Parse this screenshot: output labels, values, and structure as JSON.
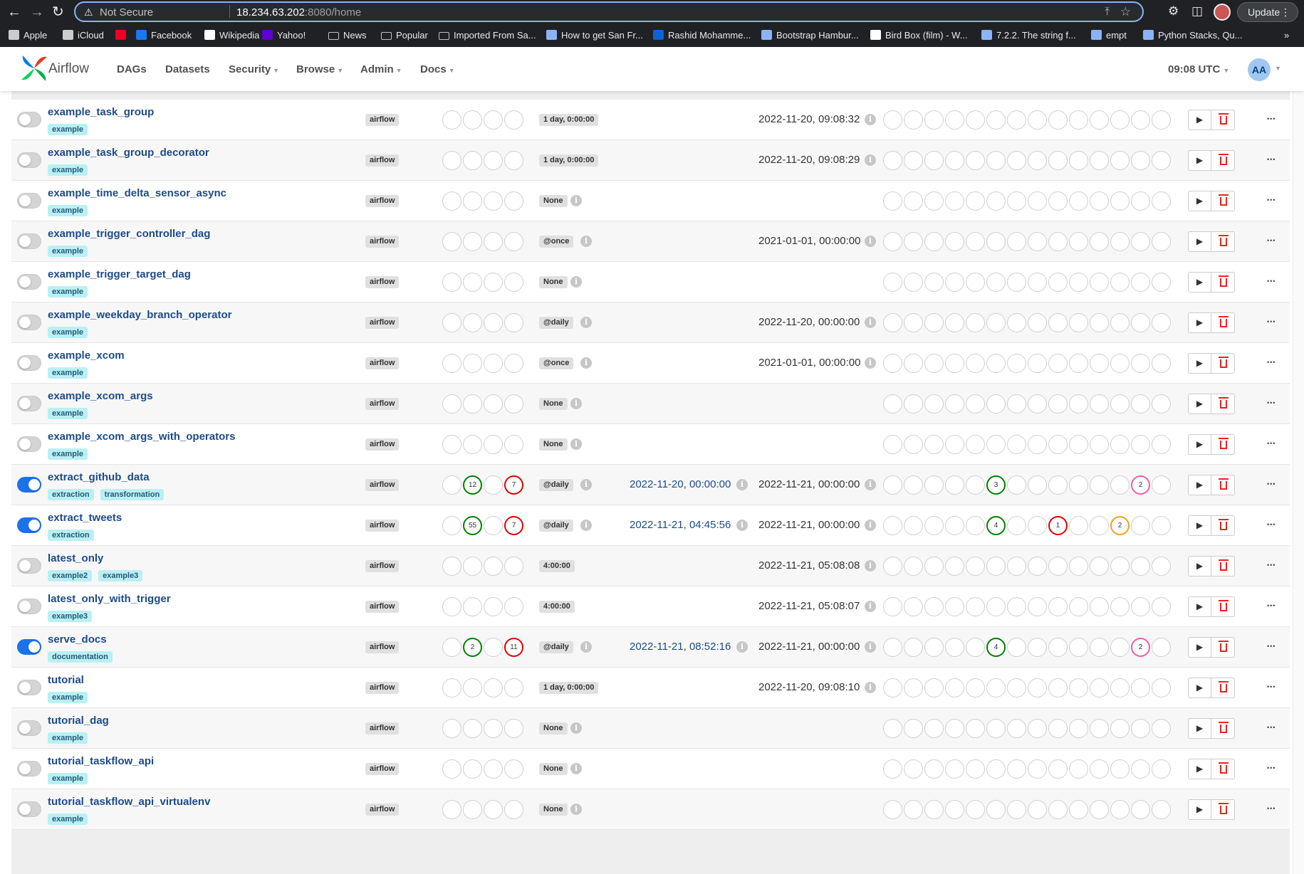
{
  "browser": {
    "security_label": "Not Secure",
    "url_host": "18.234.63.202",
    "url_rest": ":8080/home",
    "update_label": "Update",
    "bookmarks": [
      "Apple",
      "iCloud",
      "",
      "Facebook",
      "Wikipedia",
      "Yahoo!",
      "News",
      "Popular",
      "Imported From Sa...",
      "How to get San Fr...",
      "Rashid Mohamme...",
      "Bootstrap Hambur...",
      "Bird Box (film) - W...",
      "7.2.2. The string f...",
      "empt",
      "Python Stacks, Qu..."
    ]
  },
  "nav": {
    "brand": "Airflow",
    "menu": [
      "DAGs",
      "Datasets",
      "Security",
      "Browse",
      "Admin",
      "Docs"
    ],
    "time": "09:08 UTC",
    "user_initials": "AA"
  },
  "rows": [
    {
      "name": "example_task_group",
      "tags": [
        "example"
      ],
      "owner": "airflow",
      "on": false,
      "runs": [],
      "schedule": "1 day, 0:00:00",
      "sched_info": false,
      "last_run": "",
      "next_run": "2022-11-20, 09:08:32",
      "tasks": []
    },
    {
      "name": "example_task_group_decorator",
      "tags": [
        "example"
      ],
      "owner": "airflow",
      "on": false,
      "runs": [],
      "schedule": "1 day, 0:00:00",
      "sched_info": false,
      "last_run": "",
      "next_run": "2022-11-20, 09:08:29",
      "tasks": []
    },
    {
      "name": "example_time_delta_sensor_async",
      "tags": [
        "example"
      ],
      "owner": "airflow",
      "on": false,
      "runs": [],
      "schedule": "None",
      "sched_info": true,
      "last_run": "",
      "next_run": "",
      "tasks": []
    },
    {
      "name": "example_trigger_controller_dag",
      "tags": [
        "example"
      ],
      "owner": "airflow",
      "on": false,
      "runs": [],
      "schedule": "@once",
      "sched_info": true,
      "last_run": "",
      "next_run": "2021-01-01, 00:00:00",
      "tasks": []
    },
    {
      "name": "example_trigger_target_dag",
      "tags": [
        "example"
      ],
      "owner": "airflow",
      "on": false,
      "runs": [],
      "schedule": "None",
      "sched_info": true,
      "last_run": "",
      "next_run": "",
      "tasks": []
    },
    {
      "name": "example_weekday_branch_operator",
      "tags": [
        "example"
      ],
      "owner": "airflow",
      "on": false,
      "runs": [],
      "schedule": "@daily",
      "sched_info": true,
      "last_run": "",
      "next_run": "2022-11-20, 00:00:00",
      "tasks": []
    },
    {
      "name": "example_xcom",
      "tags": [
        "example"
      ],
      "owner": "airflow",
      "on": false,
      "runs": [],
      "schedule": "@once",
      "sched_info": true,
      "last_run": "",
      "next_run": "2021-01-01, 00:00:00",
      "tasks": []
    },
    {
      "name": "example_xcom_args",
      "tags": [
        "example"
      ],
      "owner": "airflow",
      "on": false,
      "runs": [],
      "schedule": "None",
      "sched_info": true,
      "last_run": "",
      "next_run": "",
      "tasks": []
    },
    {
      "name": "example_xcom_args_with_operators",
      "tags": [
        "example"
      ],
      "owner": "airflow",
      "on": false,
      "runs": [],
      "schedule": "None",
      "sched_info": true,
      "last_run": "",
      "next_run": "",
      "tasks": []
    },
    {
      "name": "extract_github_data",
      "tags": [
        "extraction",
        "transformation"
      ],
      "owner": "airflow",
      "on": true,
      "runs": [
        {
          "i": 1,
          "v": "12",
          "s": "g"
        },
        {
          "i": 3,
          "v": "7",
          "s": "r"
        }
      ],
      "schedule": "@daily",
      "sched_info": true,
      "last_run": "2022-11-20, 00:00:00",
      "next_run": "2022-11-21, 00:00:00",
      "tasks": [
        {
          "i": 5,
          "v": "3",
          "s": "g"
        },
        {
          "i": 12,
          "v": "2",
          "s": "p"
        }
      ]
    },
    {
      "name": "extract_tweets",
      "tags": [
        "extraction"
      ],
      "owner": "airflow",
      "on": true,
      "runs": [
        {
          "i": 1,
          "v": "55",
          "s": "g"
        },
        {
          "i": 3,
          "v": "7",
          "s": "r"
        }
      ],
      "schedule": "@daily",
      "sched_info": true,
      "last_run": "2022-11-21, 04:45:56",
      "next_run": "2022-11-21, 00:00:00",
      "tasks": [
        {
          "i": 5,
          "v": "4",
          "s": "g"
        },
        {
          "i": 8,
          "v": "1",
          "s": "r"
        },
        {
          "i": 11,
          "v": "2",
          "s": "o"
        }
      ]
    },
    {
      "name": "latest_only",
      "tags": [
        "example2",
        "example3"
      ],
      "owner": "airflow",
      "on": false,
      "runs": [],
      "schedule": "4:00:00",
      "sched_info": false,
      "last_run": "",
      "next_run": "2022-11-21, 05:08:08",
      "tasks": []
    },
    {
      "name": "latest_only_with_trigger",
      "tags": [
        "example3"
      ],
      "owner": "airflow",
      "on": false,
      "runs": [],
      "schedule": "4:00:00",
      "sched_info": false,
      "last_run": "",
      "next_run": "2022-11-21, 05:08:07",
      "tasks": []
    },
    {
      "name": "serve_docs",
      "tags": [
        "documentation"
      ],
      "owner": "airflow",
      "on": true,
      "runs": [
        {
          "i": 1,
          "v": "2",
          "s": "g"
        },
        {
          "i": 3,
          "v": "11",
          "s": "r"
        }
      ],
      "schedule": "@daily",
      "sched_info": true,
      "last_run": "2022-11-21, 08:52:16",
      "next_run": "2022-11-21, 00:00:00",
      "tasks": [
        {
          "i": 5,
          "v": "4",
          "s": "g"
        },
        {
          "i": 12,
          "v": "2",
          "s": "p"
        }
      ]
    },
    {
      "name": "tutorial",
      "tags": [
        "example"
      ],
      "owner": "airflow",
      "on": false,
      "runs": [],
      "schedule": "1 day, 0:00:00",
      "sched_info": false,
      "last_run": "",
      "next_run": "2022-11-20, 09:08:10",
      "tasks": []
    },
    {
      "name": "tutorial_dag",
      "tags": [
        "example"
      ],
      "owner": "airflow",
      "on": false,
      "runs": [],
      "schedule": "None",
      "sched_info": true,
      "last_run": "",
      "next_run": "",
      "tasks": []
    },
    {
      "name": "tutorial_taskflow_api",
      "tags": [
        "example"
      ],
      "owner": "airflow",
      "on": false,
      "runs": [],
      "schedule": "None",
      "sched_info": true,
      "last_run": "",
      "next_run": "",
      "tasks": []
    },
    {
      "name": "tutorial_taskflow_api_virtualenv",
      "tags": [
        "example"
      ],
      "owner": "airflow",
      "on": false,
      "runs": [],
      "schedule": "None",
      "sched_info": true,
      "last_run": "",
      "next_run": "",
      "tasks": []
    }
  ]
}
